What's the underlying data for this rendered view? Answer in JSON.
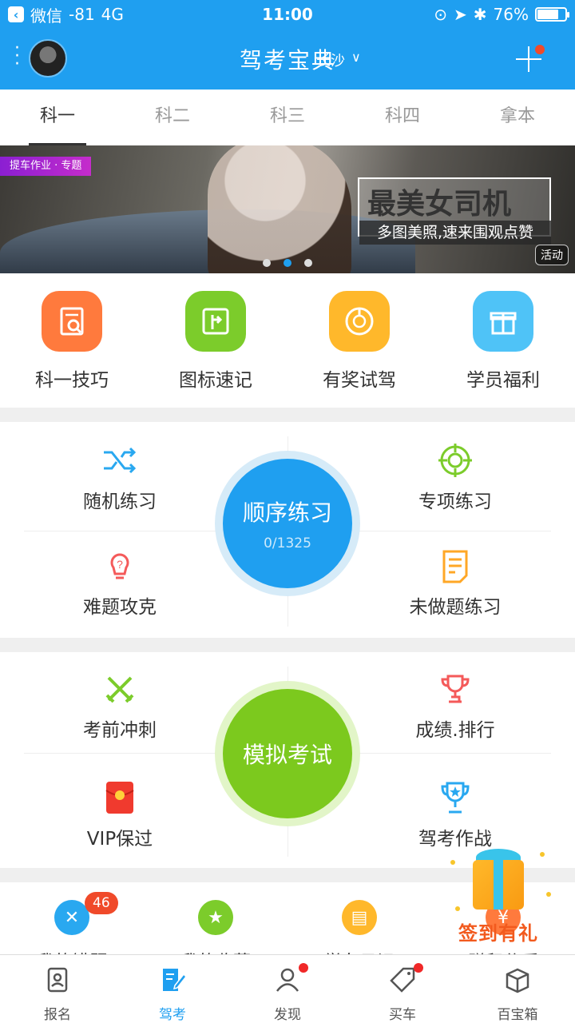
{
  "status_bar": {
    "back_app": "微信",
    "signal": "-81",
    "network": "4G",
    "time": "11:00",
    "battery": "76%",
    "battery_level": 0.76
  },
  "header": {
    "title": "驾考宝典",
    "city": "长沙",
    "city_chevron": "∨"
  },
  "tabs": [
    {
      "label": "科一",
      "active": true
    },
    {
      "label": "科二",
      "active": false
    },
    {
      "label": "科三",
      "active": false
    },
    {
      "label": "科四",
      "active": false
    },
    {
      "label": "拿本",
      "active": false
    }
  ],
  "banner": {
    "tag": "提车作业 · 专题",
    "title": "最美女司机",
    "subtitle": "多图美照,速来围观点赞",
    "badge": "活动",
    "active_dot": 2,
    "dot_count": 3
  },
  "tools": [
    {
      "label": "科一技巧",
      "icon": "book-search-icon",
      "color": "#ff7a3d"
    },
    {
      "label": "图标速记",
      "icon": "road-sign-icon",
      "color": "#7ccc2b"
    },
    {
      "label": "有奖试驾",
      "icon": "steering-wheel-icon",
      "color": "#ffb82b"
    },
    {
      "label": "学员福利",
      "icon": "gift-icon",
      "color": "#4fc3f7"
    }
  ],
  "practice": {
    "random": "随机练习",
    "special": "专项练习",
    "hard": "难题攻克",
    "undone": "未做题练习",
    "sequence": {
      "title": "顺序练习",
      "progress": "0/1325"
    }
  },
  "exam": {
    "sprint": "考前冲刺",
    "rank": "成绩.排行",
    "vip": "VIP保过",
    "battle": "驾考作战",
    "mock": "模拟考试"
  },
  "mine": {
    "items": [
      {
        "label": "我的错题",
        "icon": "wrong-icon",
        "color": "#29a8f0",
        "badge": "46"
      },
      {
        "label": "我的收藏",
        "icon": "star-icon",
        "color": "#7ccc2b"
      },
      {
        "label": "学车日记",
        "icon": "diary-icon",
        "color": "#ffb82b"
      },
      {
        "label": "赚积分币",
        "icon": "coin-icon",
        "color": "#ff7a3d"
      }
    ]
  },
  "gift": {
    "label": "签到有礼"
  },
  "bottom_nav": [
    {
      "label": "报名",
      "icon": "id-card-icon",
      "active": false,
      "dot": false
    },
    {
      "label": "驾考",
      "icon": "edit-doc-icon",
      "active": true,
      "dot": false
    },
    {
      "label": "发现",
      "icon": "person-icon",
      "active": false,
      "dot": true
    },
    {
      "label": "买车",
      "icon": "price-tag-icon",
      "active": false,
      "dot": true
    },
    {
      "label": "百宝箱",
      "icon": "box-icon",
      "active": false,
      "dot": false
    }
  ]
}
